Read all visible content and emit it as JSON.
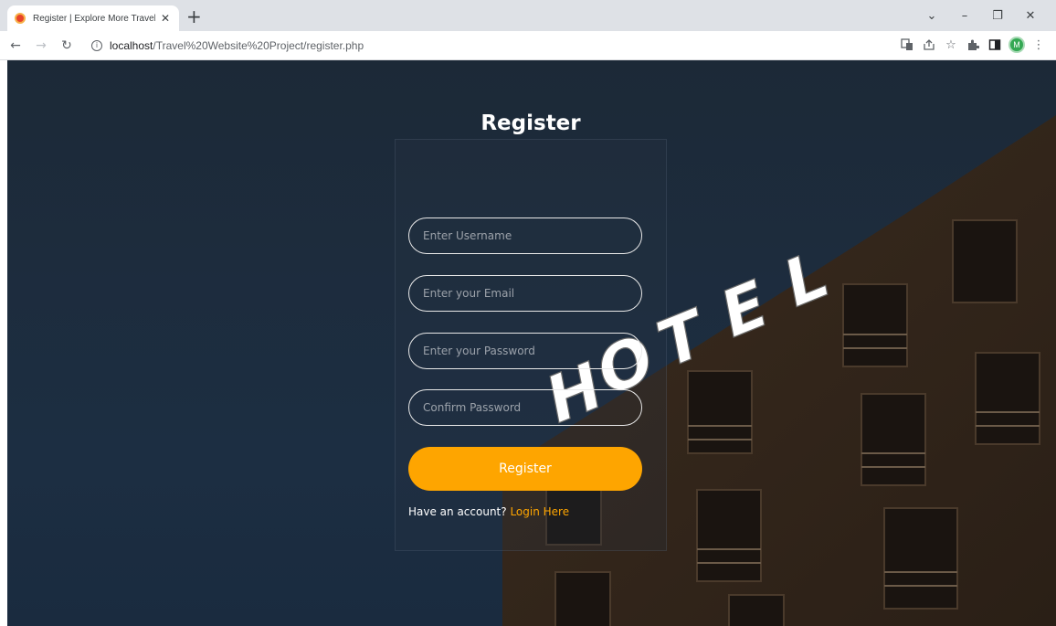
{
  "browser": {
    "tab_title": "Register | Explore More Travel Gu",
    "url_host": "localhost",
    "url_path": "/Travel%20Website%20Project/register.php",
    "profile_initial": "M"
  },
  "sign": {
    "letters": [
      "H",
      "O",
      "T",
      "E",
      "L"
    ]
  },
  "form": {
    "title": "Register",
    "username_placeholder": "Enter Username",
    "email_placeholder": "Enter your Email",
    "password_placeholder": "Enter your Password",
    "confirm_placeholder": "Confirm Password",
    "submit_label": "Register",
    "have_account_text": "Have an account?",
    "login_link_text": "Login Here"
  },
  "colors": {
    "accent": "#fea500",
    "building": "#3a2a1c",
    "sky": "#1c2b3d"
  }
}
